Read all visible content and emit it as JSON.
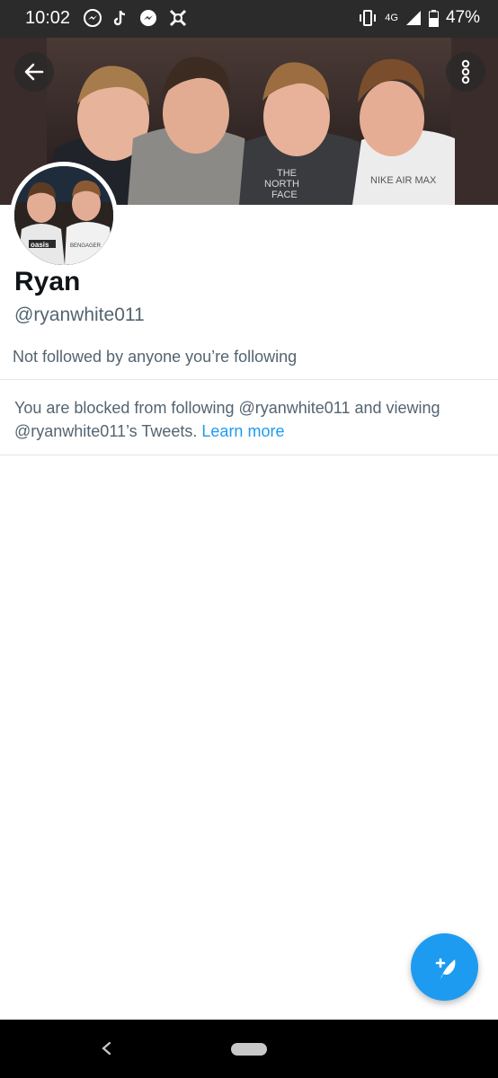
{
  "status_bar": {
    "time": "10:02",
    "network": "4G",
    "battery": "47%",
    "notification_icons": [
      "messenger-icon",
      "tiktok-icon",
      "messenger-icon",
      "app-notification-icon"
    ]
  },
  "profile": {
    "display_name": "Ryan",
    "handle": "@ryanwhite011",
    "followed_by": "Not followed by anyone you’re following",
    "blocked_message": "You are blocked from following @ryanwhite011 and viewing @ryanwhite011’s Tweets.",
    "learn_more": "Learn more"
  },
  "banner_image": {
    "shirt_texts": [
      "THE",
      "NORTH",
      "FACE",
      "NIKE AIR MAX"
    ]
  },
  "avatar_image": {
    "shirt_texts": [
      "oasis",
      "BENGAGER"
    ]
  },
  "colors": {
    "accent": "#1d9bf0",
    "text_primary": "#0f1419",
    "text_secondary": "#536471",
    "status_bar": "#2b2b2b",
    "nav_bar": "#000000"
  }
}
